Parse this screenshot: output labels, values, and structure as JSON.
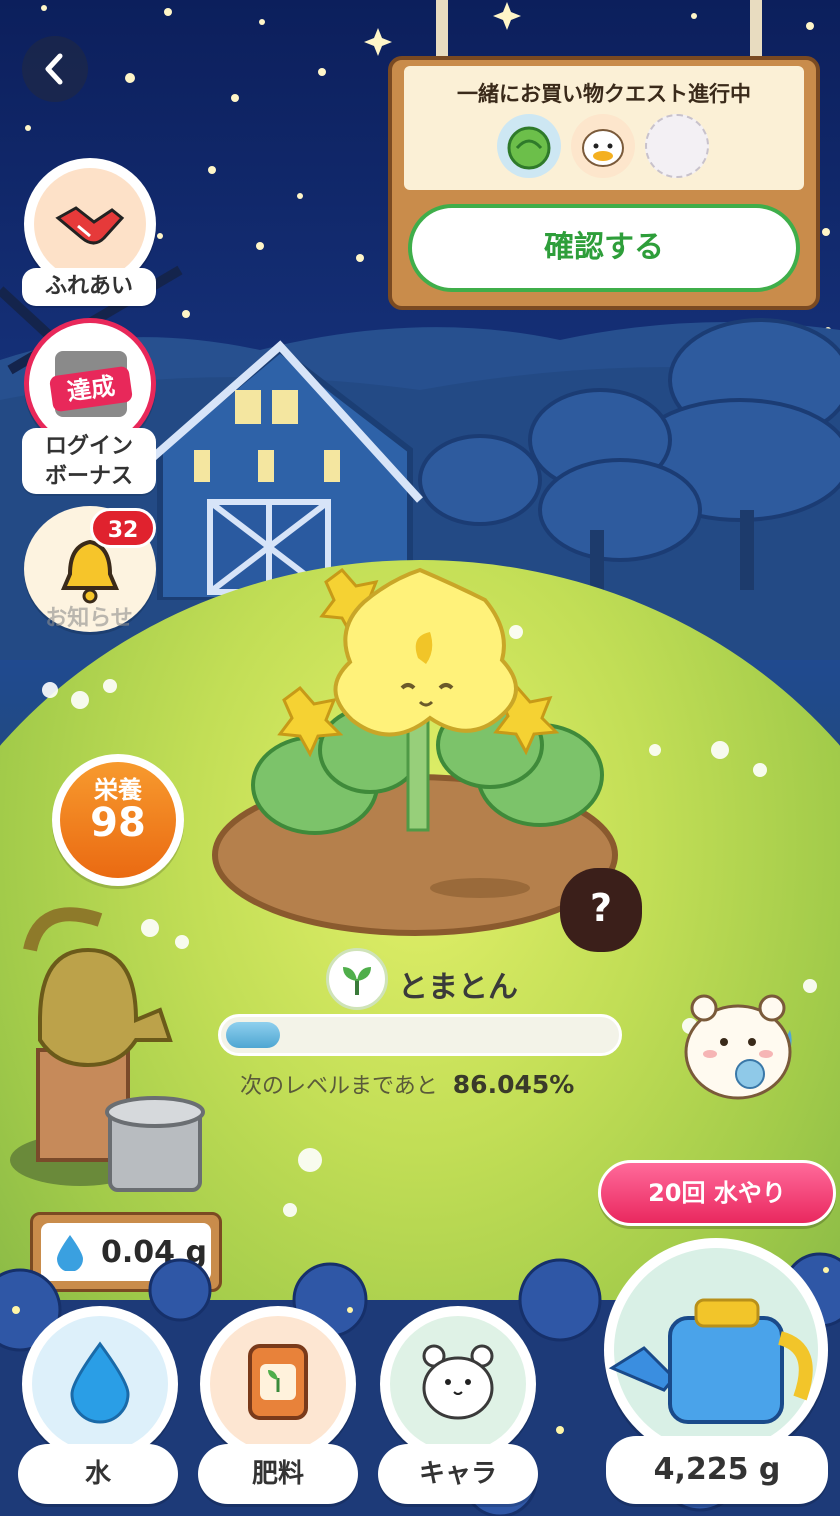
{
  "colors": {
    "sky_top": "#0c1f5c",
    "grass": "#a8cf4a",
    "accent_green": "#2e9e3a",
    "nutrition_orange": "#f07a1a",
    "notification_red": "#e0222e",
    "water_btn_pink": "#e9285f",
    "wood": "#c98c4b",
    "progress_blue": "#5fb3d8"
  },
  "nav": {
    "back_icon": "chevron-left-icon"
  },
  "quest": {
    "title": "一緒にお買い物クエスト進行中",
    "confirm_label": "確認する",
    "slots": [
      "cabbage-icon",
      "duck-icon",
      "empty-slot"
    ]
  },
  "side": {
    "fureai_label": "ふれあい",
    "fureai_icon": "handshake-icon",
    "login_badge": "達成",
    "login_label_1": "ログイン",
    "login_label_2": "ボーナス",
    "notice_label": "お知らせ",
    "notice_count": "32"
  },
  "nutrition": {
    "label": "栄養",
    "value": "98"
  },
  "plant": {
    "name": "とまとん",
    "name_icon": "sprout-icon",
    "progress_text": "次のレベルまであと",
    "progress_value": "86.045%",
    "progress_fill": 0.14,
    "mystery_mark": "?"
  },
  "water_amount": {
    "icon": "water-drop-icon",
    "value": "0.04 g"
  },
  "watering": {
    "label": "20回 水やり",
    "total": "4,225 g"
  },
  "bottom_nav": {
    "water_label": "水",
    "fertilizer_label": "肥料",
    "character_label": "キャラ"
  }
}
